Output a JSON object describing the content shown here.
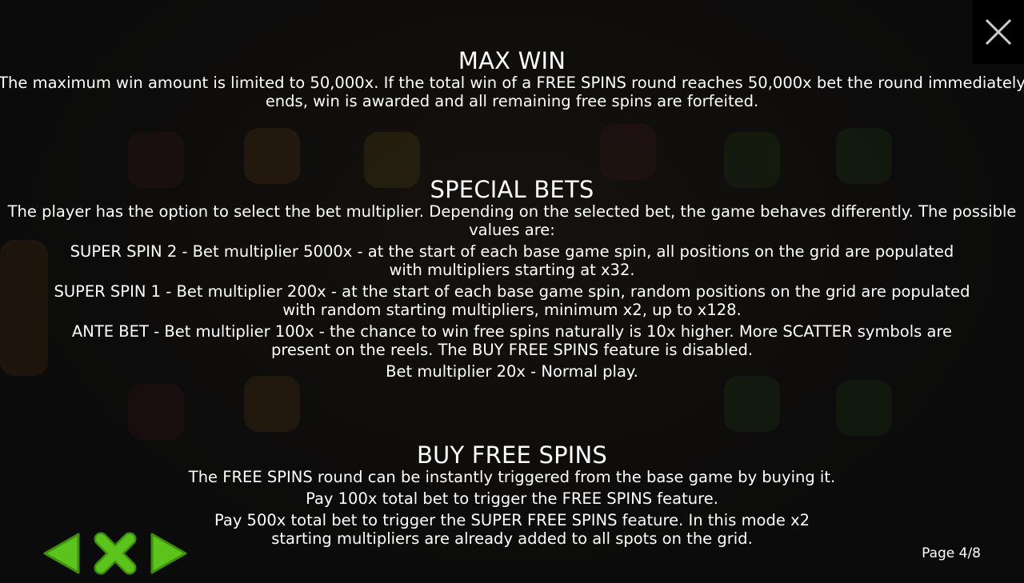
{
  "sections": {
    "max_win": {
      "title": "MAX WIN",
      "text": "The maximum win amount is limited to 50,000x. If the total win of a FREE SPINS round reaches 50,000x bet the round immediately ends, win is awarded and all remaining free spins are forfeited."
    },
    "special_bets": {
      "title": "SPECIAL BETS",
      "intro": "The player has the option to select the bet multiplier. Depending on the selected bet, the game behaves differently. The possible values are:",
      "items": [
        "SUPER SPIN 2 - Bet multiplier 5000x - at the start of each base game spin, all positions on the grid are populated with multipliers starting at x32.",
        "SUPER SPIN 1 - Bet multiplier 200x - at the start of each base game spin, random positions on the grid are populated with random starting multipliers, minimum x2, up to x128.",
        "ANTE BET - Bet multiplier 100x - the chance to win free spins naturally is 10x higher. More SCATTER symbols are present on the reels. The BUY FREE SPINS feature is disabled.",
        "Bet multiplier 20x - Normal play."
      ]
    },
    "buy_free_spins": {
      "title": "BUY FREE SPINS",
      "items": [
        "The FREE SPINS round can be instantly triggered from the base game by buying it.",
        "Pay 100x total bet to trigger the FREE SPINS feature.",
        "Pay 500x total bet to trigger the SUPER FREE SPINS feature. In this mode x2 starting multipliers are already added to all spots on the grid."
      ]
    }
  },
  "page_indicator": "Page 4/8",
  "icons": {
    "close": "close-icon",
    "prev": "arrow-left-icon",
    "exit": "x-icon",
    "next": "arrow-right-icon"
  },
  "colors": {
    "nav_green": "#5cc21c",
    "nav_green_dark": "#3f8f0f",
    "text": "#ffffff",
    "background": "#0b0b0b"
  }
}
